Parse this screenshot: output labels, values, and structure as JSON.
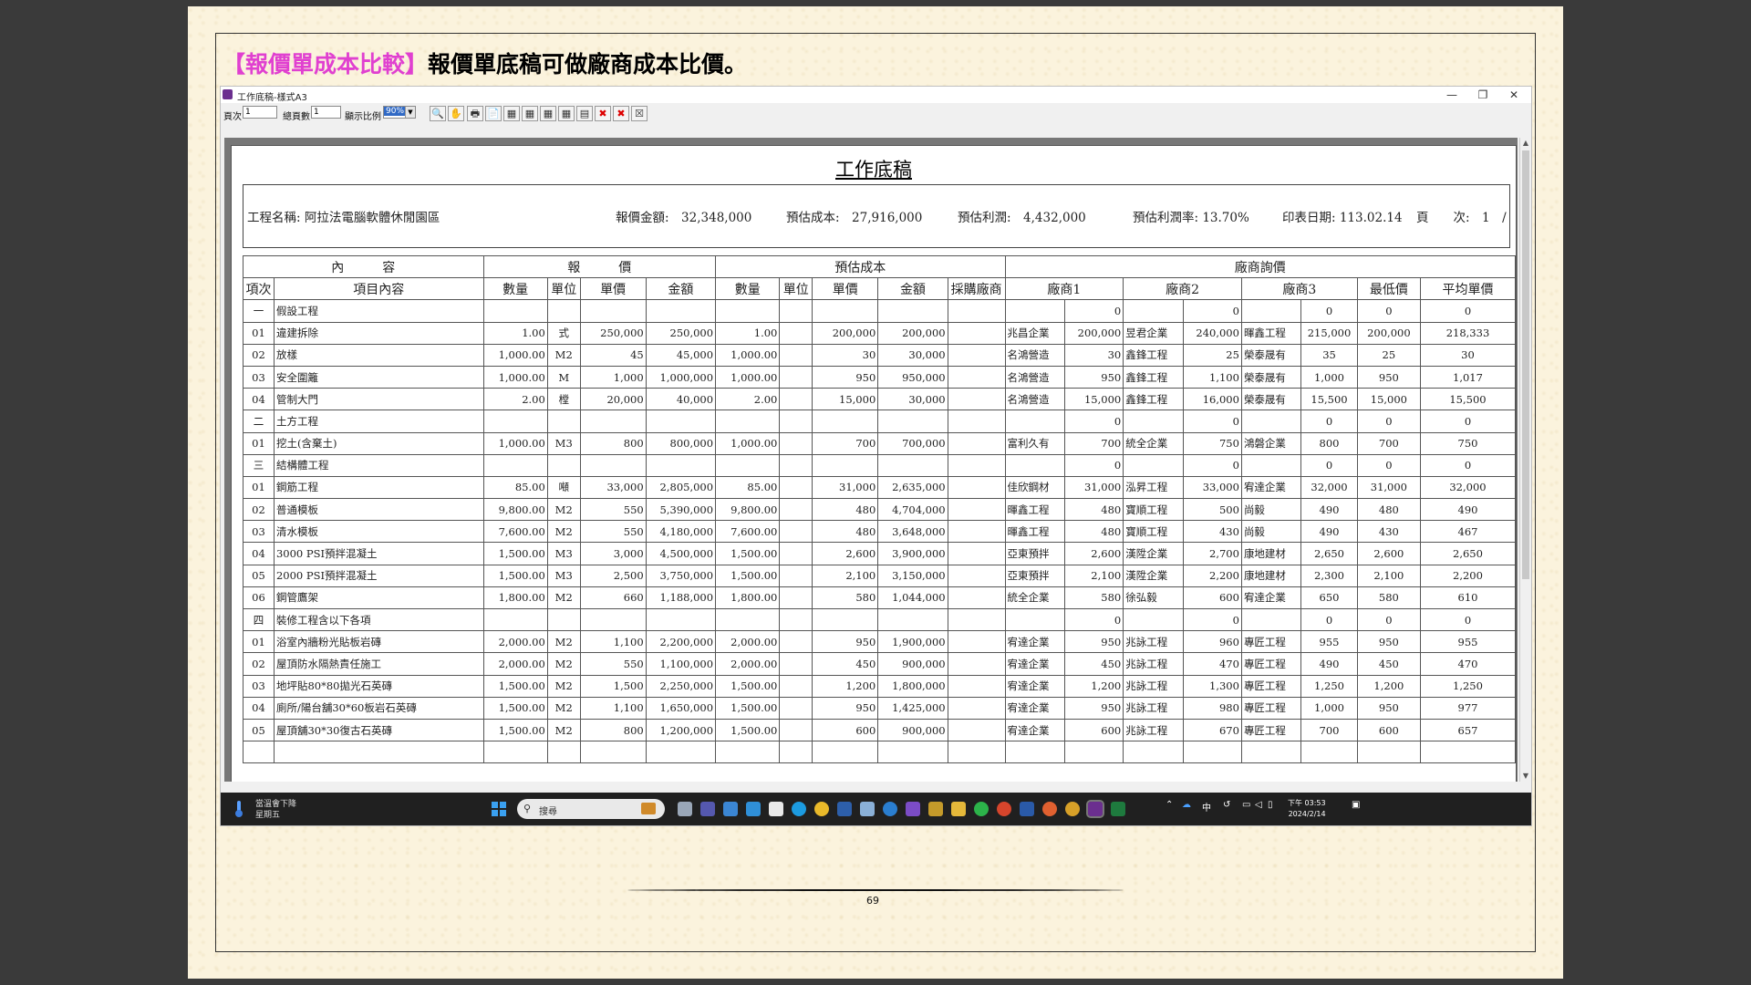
{
  "slide": {
    "headline_bracket": "【報價單成本比較】",
    "headline_rest": "報價單底稿可做廠商成本比價。",
    "page_number": "69"
  },
  "window": {
    "title": "工作底稿-樣式A3",
    "controls": {
      "minimize": "—",
      "restore": "❐",
      "close": "✕"
    }
  },
  "toolbar": {
    "page_label": "頁次",
    "page_value": "1",
    "total_label": "總頁數",
    "total_value": "1",
    "zoom_label": "顯示比例",
    "zoom_value": "90%",
    "buttons": [
      "🔍",
      "✋",
      "🖶",
      "📄",
      "▦",
      "▦",
      "▦",
      "▦",
      "▤",
      "✖",
      "✖",
      "☒"
    ]
  },
  "report": {
    "title": "工作底稿",
    "project_label": "工程名稱: 阿拉法電腦軟體休閒園區",
    "quote_total": "報價金額:　32,348,000",
    "est_cost": "預估成本:　27,916,000",
    "est_profit": "預估利潤:　4,432,000",
    "est_rate": "預估利潤率: 13.70%",
    "print_date": "印表日期: 113.02.14",
    "page_info": "頁　　次:　1　/　1",
    "group_headers": [
      "內　　　容",
      "報　　　價",
      "預估成本",
      "廠商詢價"
    ],
    "col_headers": [
      "項次",
      "項目內容",
      "數量",
      "單位",
      "單價",
      "金額",
      "數量",
      "單位",
      "單價",
      "金額",
      "採購廠商",
      "廠商1",
      "",
      "廠商2",
      "",
      "廠商3",
      "",
      "最低價",
      "平均單價"
    ],
    "rows": [
      [
        "一",
        "假設工程",
        "",
        "",
        "",
        "",
        "",
        "",
        "",
        "",
        "",
        "",
        "0",
        "",
        "0",
        "",
        "0",
        "0",
        "0"
      ],
      [
        "01",
        "違建拆除",
        "1.00",
        "式",
        "250,000",
        "250,000",
        "1.00",
        "",
        "200,000",
        "200,000",
        "",
        "兆昌企業",
        "200,000",
        "昱君企業",
        "240,000",
        "暉鑫工程",
        "215,000",
        "200,000",
        "218,333"
      ],
      [
        "02",
        "放樣",
        "1,000.00",
        "M2",
        "45",
        "45,000",
        "1,000.00",
        "",
        "30",
        "30,000",
        "",
        "名鴻營造",
        "30",
        "鑫鋒工程",
        "25",
        "榮泰晟有",
        "35",
        "25",
        "30"
      ],
      [
        "03",
        "安全圍籬",
        "1,000.00",
        "M",
        "1,000",
        "1,000,000",
        "1,000.00",
        "",
        "950",
        "950,000",
        "",
        "名鴻營造",
        "950",
        "鑫鋒工程",
        "1,100",
        "榮泰晟有",
        "1,000",
        "950",
        "1,017"
      ],
      [
        "04",
        "管制大門",
        "2.00",
        "樘",
        "20,000",
        "40,000",
        "2.00",
        "",
        "15,000",
        "30,000",
        "",
        "名鴻營造",
        "15,000",
        "鑫鋒工程",
        "16,000",
        "榮泰晟有",
        "15,500",
        "15,000",
        "15,500"
      ],
      [
        "二",
        "土方工程",
        "",
        "",
        "",
        "",
        "",
        "",
        "",
        "",
        "",
        "",
        "0",
        "",
        "0",
        "",
        "0",
        "0",
        "0"
      ],
      [
        "01",
        "挖土(含棄土)",
        "1,000.00",
        "M3",
        "800",
        "800,000",
        "1,000.00",
        "",
        "700",
        "700,000",
        "",
        "富利久有",
        "700",
        "統全企業",
        "750",
        "鴻磐企業",
        "800",
        "700",
        "750"
      ],
      [
        "三",
        "結構體工程",
        "",
        "",
        "",
        "",
        "",
        "",
        "",
        "",
        "",
        "",
        "0",
        "",
        "0",
        "",
        "0",
        "0",
        "0"
      ],
      [
        "01",
        "鋼筋工程",
        "85.00",
        "噸",
        "33,000",
        "2,805,000",
        "85.00",
        "",
        "31,000",
        "2,635,000",
        "",
        "佳欣鋼材",
        "31,000",
        "泓昇工程",
        "33,000",
        "宥達企業",
        "32,000",
        "31,000",
        "32,000"
      ],
      [
        "02",
        "普通模板",
        "9,800.00",
        "M2",
        "550",
        "5,390,000",
        "9,800.00",
        "",
        "480",
        "4,704,000",
        "",
        "暉鑫工程",
        "480",
        "寶順工程",
        "500",
        "尚毅",
        "490",
        "480",
        "490"
      ],
      [
        "03",
        "清水模板",
        "7,600.00",
        "M2",
        "550",
        "4,180,000",
        "7,600.00",
        "",
        "480",
        "3,648,000",
        "",
        "暉鑫工程",
        "480",
        "寶順工程",
        "430",
        "尚毅",
        "490",
        "430",
        "467"
      ],
      [
        "04",
        "3000 PSI預拌混凝土",
        "1,500.00",
        "M3",
        "3,000",
        "4,500,000",
        "1,500.00",
        "",
        "2,600",
        "3,900,000",
        "",
        "亞東預拌",
        "2,600",
        "漢陞企業",
        "2,700",
        "康地建材",
        "2,650",
        "2,600",
        "2,650"
      ],
      [
        "05",
        "2000 PSI預拌混凝土",
        "1,500.00",
        "M3",
        "2,500",
        "3,750,000",
        "1,500.00",
        "",
        "2,100",
        "3,150,000",
        "",
        "亞東預拌",
        "2,100",
        "漢陞企業",
        "2,200",
        "康地建材",
        "2,300",
        "2,100",
        "2,200"
      ],
      [
        "06",
        "鋼管鷹架",
        "1,800.00",
        "M2",
        "660",
        "1,188,000",
        "1,800.00",
        "",
        "580",
        "1,044,000",
        "",
        "統全企業",
        "580",
        "徐弘毅",
        "600",
        "宥達企業",
        "650",
        "580",
        "610"
      ],
      [
        "四",
        "裝修工程含以下各項",
        "",
        "",
        "",
        "",
        "",
        "",
        "",
        "",
        "",
        "",
        "0",
        "",
        "0",
        "",
        "0",
        "0",
        "0"
      ],
      [
        "01",
        "浴室內牆粉光貼板岩磚",
        "2,000.00",
        "M2",
        "1,100",
        "2,200,000",
        "2,000.00",
        "",
        "950",
        "1,900,000",
        "",
        "宥達企業",
        "950",
        "兆詠工程",
        "960",
        "專匠工程",
        "955",
        "950",
        "955"
      ],
      [
        "02",
        "屋頂防水隔熱責任施工",
        "2,000.00",
        "M2",
        "550",
        "1,100,000",
        "2,000.00",
        "",
        "450",
        "900,000",
        "",
        "宥達企業",
        "450",
        "兆詠工程",
        "470",
        "專匠工程",
        "490",
        "450",
        "470"
      ],
      [
        "03",
        "地坪貼80*80拋光石英磚",
        "1,500.00",
        "M2",
        "1,500",
        "2,250,000",
        "1,500.00",
        "",
        "1,200",
        "1,800,000",
        "",
        "宥達企業",
        "1,200",
        "兆詠工程",
        "1,300",
        "專匠工程",
        "1,250",
        "1,200",
        "1,250"
      ],
      [
        "04",
        "廁所/陽台舖30*60板岩石英磚",
        "1,500.00",
        "M2",
        "1,100",
        "1,650,000",
        "1,500.00",
        "",
        "950",
        "1,425,000",
        "",
        "宥達企業",
        "950",
        "兆詠工程",
        "980",
        "專匠工程",
        "1,000",
        "950",
        "977"
      ],
      [
        "05",
        "屋頂舖30*30復古石英磚",
        "1,500.00",
        "M2",
        "800",
        "1,200,000",
        "1,500.00",
        "",
        "600",
        "900,000",
        "",
        "宥達企業",
        "600",
        "兆詠工程",
        "670",
        "專匠工程",
        "700",
        "600",
        "657"
      ],
      [
        "",
        "",
        "",
        "",
        "",
        "",
        "",
        "",
        "",
        "",
        "",
        "",
        "",
        "",
        "",
        "",
        "",
        "",
        ""
      ]
    ]
  },
  "taskbar": {
    "weather_line1": "當溫會下降",
    "weather_line2": "星期五",
    "search_placeholder": "搜尋",
    "ime": "中",
    "time": "下午 03:53",
    "date": "2024/2/14"
  }
}
